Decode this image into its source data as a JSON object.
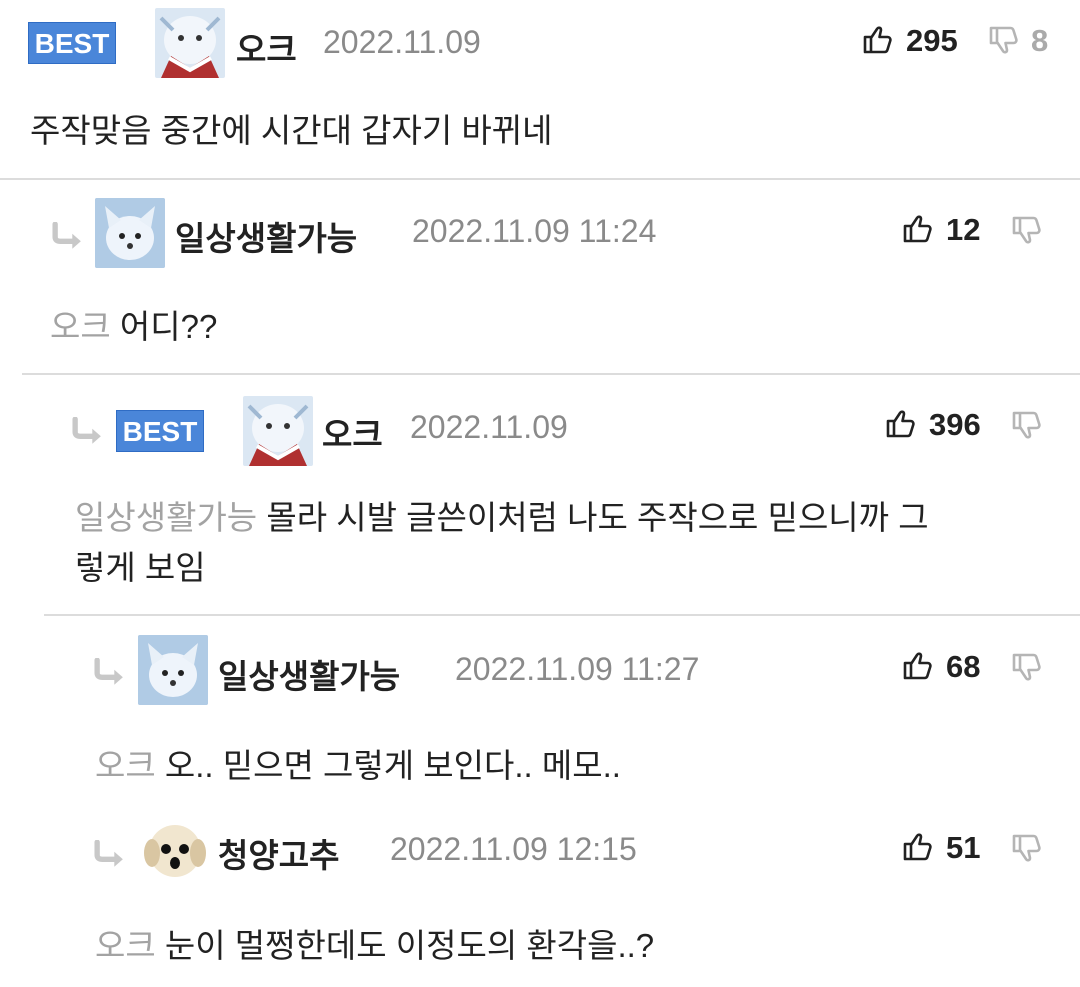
{
  "comments": [
    {
      "best": "BEST",
      "nick": "오크",
      "date": "2022.11.09",
      "likes": "295",
      "dislikes": "8",
      "body": "주작맞음 중간에 시간대 갑자기 바뀌네"
    },
    {
      "nick": "일상생활가능",
      "date": "2022.11.09 11:24",
      "likes": "12",
      "mention": "오크",
      "body": "어디??"
    },
    {
      "best": "BEST",
      "nick": "오크",
      "date": "2022.11.09",
      "likes": "396",
      "mention": "일상생활가능",
      "body_line1": "몰라 시발 글쓴이처럼 나도 주작으로 믿으니까 그",
      "body_line2": "렇게 보임"
    },
    {
      "nick": "일상생활가능",
      "date": "2022.11.09 11:27",
      "likes": "68",
      "mention": "오크",
      "body": "오.. 믿으면 그렇게 보인다.. 메모.."
    },
    {
      "nick": "청양고추",
      "date": "2022.11.09 12:15",
      "likes": "51",
      "mention": "오크",
      "body": "눈이 멀쩡한데도 이정도의 환각을..?"
    }
  ],
  "icons": {
    "like": "thumbs-up-icon",
    "dislike": "thumbs-down-icon",
    "reply": "reply-arrow-icon"
  },
  "colors": {
    "best_badge": "#4a86d9",
    "mention": "#a3a3a3",
    "date": "#8a8a8a"
  }
}
